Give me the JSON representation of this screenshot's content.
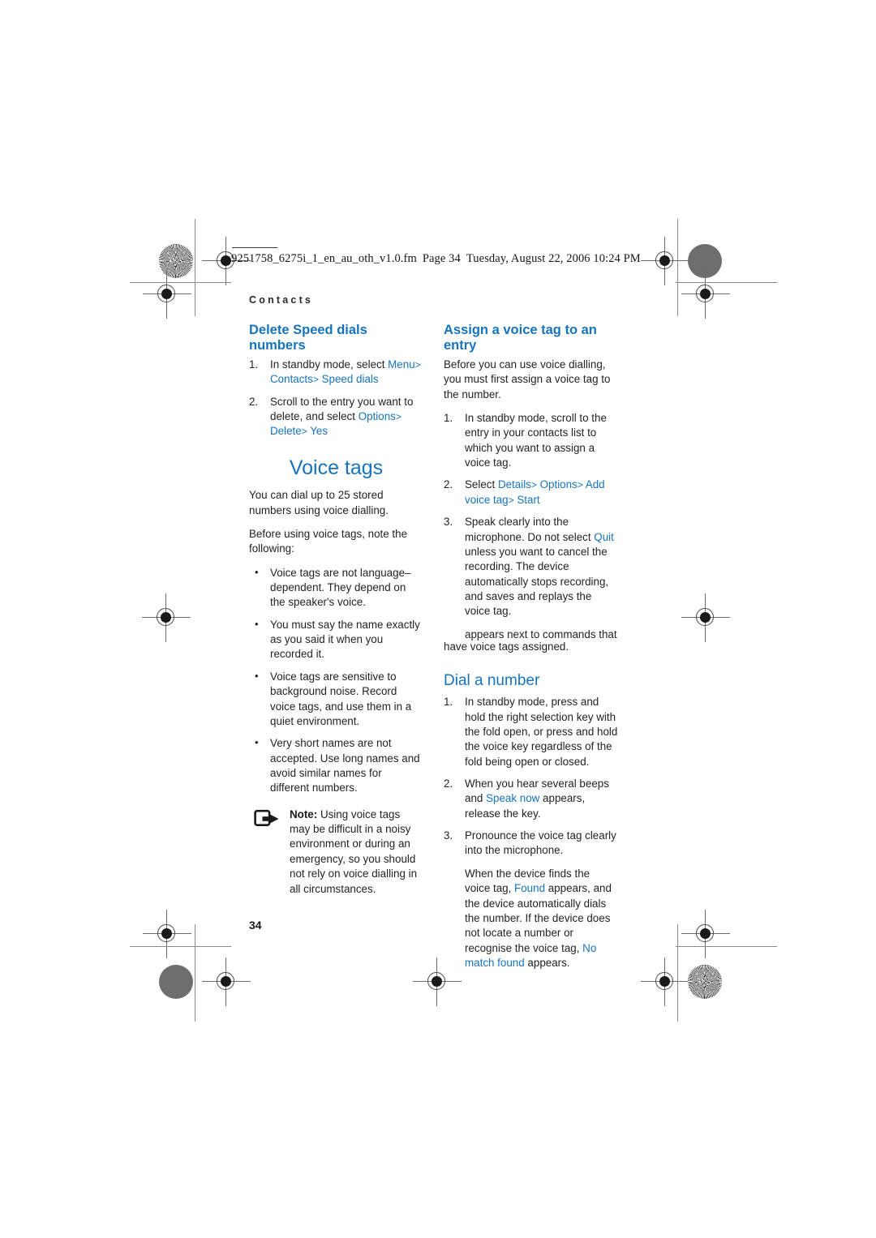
{
  "print_info": {
    "filename": "9251758_6275i_1_en_au_oth_v1.0.fm",
    "page_label": "Page 34",
    "timestamp": "Tuesday, August 22, 2006  10:24 PM"
  },
  "running_head": "Contacts",
  "folio": "34",
  "colors": {
    "accent_blue": "#1674bd",
    "body_text": "#232323",
    "mark_gray": "#6e6e6e"
  },
  "left_column": {
    "speed_dials": {
      "heading": "Delete Speed dials numbers",
      "steps": [
        {
          "num": "1.",
          "parts": [
            {
              "t": "In standby mode, select ",
              "s": "plain"
            },
            {
              "t": "Menu",
              "s": "ui"
            },
            {
              "t": ">",
              "s": "sep"
            },
            {
              "t": " ",
              "s": "plain"
            },
            {
              "t": "Contacts",
              "s": "ui"
            },
            {
              "t": ">",
              "s": "sep"
            },
            {
              "t": " ",
              "s": "plain"
            },
            {
              "t": "Speed dials",
              "s": "ui"
            }
          ]
        },
        {
          "num": "2.",
          "parts": [
            {
              "t": "Scroll to the entry you want to delete, and select ",
              "s": "plain"
            },
            {
              "t": "Options",
              "s": "ui"
            },
            {
              "t": ">",
              "s": "sep"
            },
            {
              "t": " ",
              "s": "plain"
            },
            {
              "t": "Delete",
              "s": "ui"
            },
            {
              "t": ">",
              "s": "sep"
            },
            {
              "t": " ",
              "s": "plain"
            },
            {
              "t": "Yes",
              "s": "ui"
            }
          ]
        }
      ]
    },
    "voice_tags": {
      "heading": "Voice tags",
      "intro": "You can dial up to 25 stored numbers using voice dialling.",
      "before": "Before using voice tags, note the following:",
      "bullets": [
        "Voice tags are not language–dependent. They depend on the speaker's voice.",
        "You must say the name exactly as you said it when you recorded it.",
        "Voice tags are sensitive to background noise. Record voice tags, and use them in a quiet environment.",
        "Very short names are not accepted. Use long names and avoid similar names for different numbers."
      ],
      "note": {
        "label": "Note:",
        "text": " Using voice tags may be difficult in a noisy environment or during an emergency, so you should not rely on voice dialling in all circumstances."
      }
    }
  },
  "right_column": {
    "assign": {
      "heading": "Assign a voice tag to an entry",
      "intro": "Before you can use voice dialling, you must first assign a voice tag to the number.",
      "steps": [
        {
          "num": "1.",
          "parts": [
            {
              "t": "In standby mode, scroll to the entry in your contacts list to which you want to assign a voice tag.",
              "s": "plain"
            }
          ]
        },
        {
          "num": "2.",
          "parts": [
            {
              "t": "Select ",
              "s": "plain"
            },
            {
              "t": "Details",
              "s": "ui"
            },
            {
              "t": ">",
              "s": "sep"
            },
            {
              "t": " ",
              "s": "plain"
            },
            {
              "t": "Options",
              "s": "ui"
            },
            {
              "t": ">",
              "s": "sep"
            },
            {
              "t": " ",
              "s": "plain"
            },
            {
              "t": "Add voice tag",
              "s": "ui"
            },
            {
              "t": ">",
              "s": "sep"
            },
            {
              "t": " ",
              "s": "plain"
            },
            {
              "t": "Start",
              "s": "ui"
            }
          ]
        },
        {
          "num": "3.",
          "parts": [
            {
              "t": "Speak clearly into the microphone. Do not select ",
              "s": "plain"
            },
            {
              "t": "Quit",
              "s": "ui"
            },
            {
              "t": " unless you want to cancel the recording. The device automatically stops recording, and saves and replays the voice tag.",
              "s": "plain"
            }
          ]
        }
      ],
      "trailing_note_indent": "appears next to commands that",
      "trailing_note_rest": "have voice tags assigned."
    },
    "dial": {
      "heading": "Dial a number",
      "steps": [
        {
          "num": "1.",
          "parts": [
            {
              "t": "In standby mode, press and hold the right selection key with the fold open, or press and hold the voice key regardless of the fold being open or closed.",
              "s": "plain"
            }
          ]
        },
        {
          "num": "2.",
          "parts": [
            {
              "t": "When you hear several beeps and ",
              "s": "plain"
            },
            {
              "t": "Speak now",
              "s": "ui"
            },
            {
              "t": " appears, release the key.",
              "s": "plain"
            }
          ]
        },
        {
          "num": "3.",
          "parts": [
            {
              "t": "Pronounce the voice tag clearly into the microphone.",
              "s": "plain"
            }
          ]
        }
      ],
      "result_parts": [
        {
          "t": "When the device finds the voice tag, ",
          "s": "plain"
        },
        {
          "t": "Found",
          "s": "ui"
        },
        {
          "t": " appears, and the device automatically dials the number. If the device does not locate a number or recognise the voice tag, ",
          "s": "plain"
        },
        {
          "t": "No match found",
          "s": "ui"
        },
        {
          "t": " appears.",
          "s": "plain"
        }
      ]
    }
  }
}
